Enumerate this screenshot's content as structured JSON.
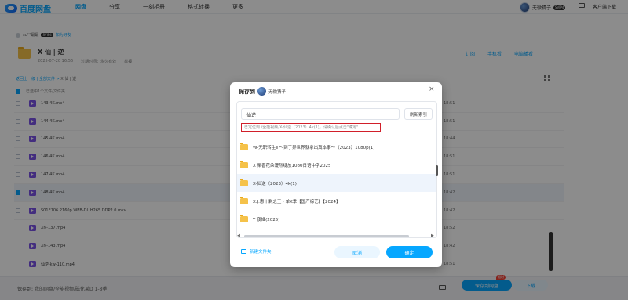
{
  "app": {
    "logo": "百度网盘"
  },
  "nav": [
    "网盘",
    "分享",
    "一刻相册",
    "格式转换",
    "更多"
  ],
  "user": {
    "name": "无微猜子",
    "badge": "SVIP4"
  },
  "client_download": "客户端下载",
  "share": {
    "sharer": "sc**最最",
    "sharer_badge": "SVIP4",
    "follow": "加为好友",
    "title": "X 仙 | 逆",
    "created": "2025-07-20 16:56",
    "expiry": "过期时间：永久有效",
    "report": "举报",
    "actions": [
      "订阅",
      "手机看",
      "电脑播看"
    ]
  },
  "breadcrumb": {
    "back": "返回上一级",
    "all": "全部文件",
    "current": "X 仙 | 逆"
  },
  "selection_info": "已选中1个文件/文件夹",
  "files": [
    {
      "name": "143.4K.mp4",
      "time": "18:51",
      "selected": false
    },
    {
      "name": "144.4K.mp4",
      "time": "18:51",
      "selected": false
    },
    {
      "name": "145.4K.mp4",
      "time": "18:44",
      "selected": false
    },
    {
      "name": "146.4K.mp4",
      "time": "18:51",
      "selected": false
    },
    {
      "name": "147.4K.mp4",
      "time": "18:51",
      "selected": false
    },
    {
      "name": "148.4K.mp4",
      "time": "18:42",
      "selected": true
    },
    {
      "name": "S01E106.2160p.WEB-DL.H265.DDP2.0.mkv",
      "time": "18:42",
      "selected": false
    },
    {
      "name": "XN-137.mp4",
      "time": "18:52",
      "selected": false
    },
    {
      "name": "XN-143.mp4",
      "time": "18:42",
      "selected": false
    },
    {
      "name": "仙逆-kw-110.mp4",
      "time": "18:51",
      "selected": false
    }
  ],
  "bottom": {
    "save_to_label": "保存到:",
    "save_path": "我的网盘/全能视频/磁化某D 1-8季",
    "save_button": "保存到网盘",
    "save_badge": "限时",
    "download_button": "下载"
  },
  "dialog": {
    "title": "保存到",
    "user": "无微猜子",
    "close": "×",
    "search_value": "仙逆",
    "refresh": "刷新索引",
    "hint": "已定位到 /全能视频/X-仙逆（2023）4k(1)，请确认后点击\"确定\"",
    "folders": [
      {
        "name": "W-无职转生Ⅱ ～到了异世界就拿出真本事～（2023）1080p(1)",
        "selected": false
      },
      {
        "name": "X 栗香花朵漫然绽放1080日语中字2025",
        "selected": false
      },
      {
        "name": "X-仙逆（2023）4k(1)",
        "selected": true
      },
      {
        "name": "X.J.惠丨剩之王 · 单K季【国产综艺】【2024】",
        "selected": false
      },
      {
        "name": "Y 夜姬(2025)",
        "selected": false
      }
    ],
    "new_folder": "新建文件夹",
    "cancel": "取消",
    "confirm": "确定"
  }
}
